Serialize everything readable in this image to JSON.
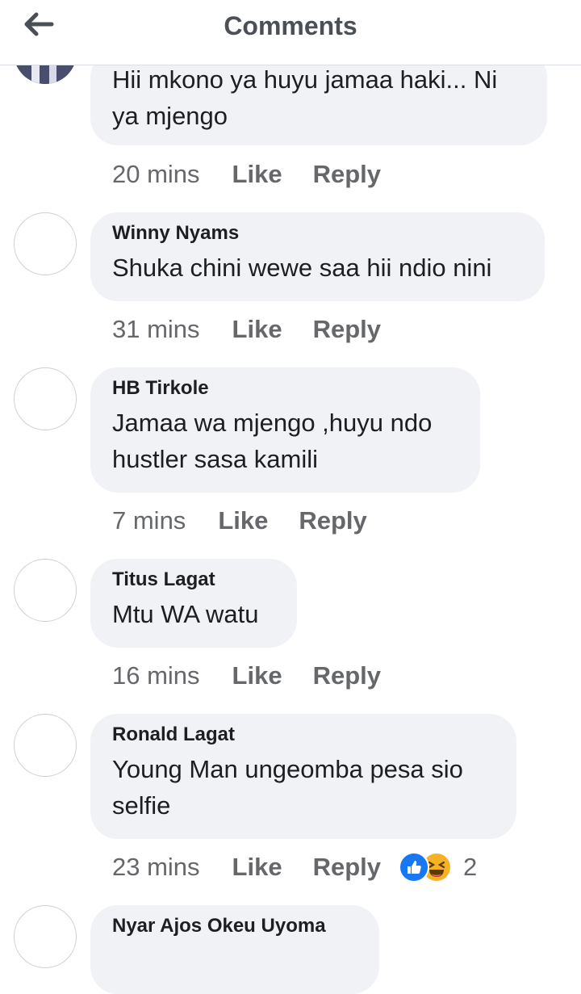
{
  "header": {
    "title": "Comments",
    "back_icon": "arrow-left-icon"
  },
  "comments": [
    {
      "author": "",
      "text_lines": [
        "Hii mkono ya huyu jamaa haki... Ni",
        "ya mjengo"
      ],
      "time": "20 mins",
      "like_label": "Like",
      "reply_label": "Reply"
    },
    {
      "author": "Winny Nyams",
      "text_lines": [
        "Shuka chini wewe saa hii ndio nini"
      ],
      "time": "31 mins",
      "like_label": "Like",
      "reply_label": "Reply"
    },
    {
      "author": "HB Tirkole",
      "text_lines": [
        "Jamaa wa mjengo ,huyu ndo",
        "hustler sasa kamili"
      ],
      "time": "7 mins",
      "like_label": "Like",
      "reply_label": "Reply"
    },
    {
      "author": "Titus Lagat",
      "text_lines": [
        "Mtu WA watu"
      ],
      "time": "16 mins",
      "like_label": "Like",
      "reply_label": "Reply"
    },
    {
      "author": "Ronald Lagat",
      "text_lines": [
        "Young Man ungeomba pesa sio",
        "selfie"
      ],
      "time": "23 mins",
      "like_label": "Like",
      "reply_label": "Reply",
      "reactions": {
        "icons": [
          "like-reaction-icon",
          "haha-reaction-icon"
        ],
        "count": "2"
      }
    },
    {
      "author": "Nyar Ajos Okeu Uyoma",
      "text_lines": [],
      "time": "",
      "like_label": "",
      "reply_label": ""
    }
  ],
  "colors": {
    "bubble": "#f0f2f5",
    "meta_text": "#65676b",
    "like_reaction": "#1877f2",
    "haha_reaction": "#f7b125"
  }
}
